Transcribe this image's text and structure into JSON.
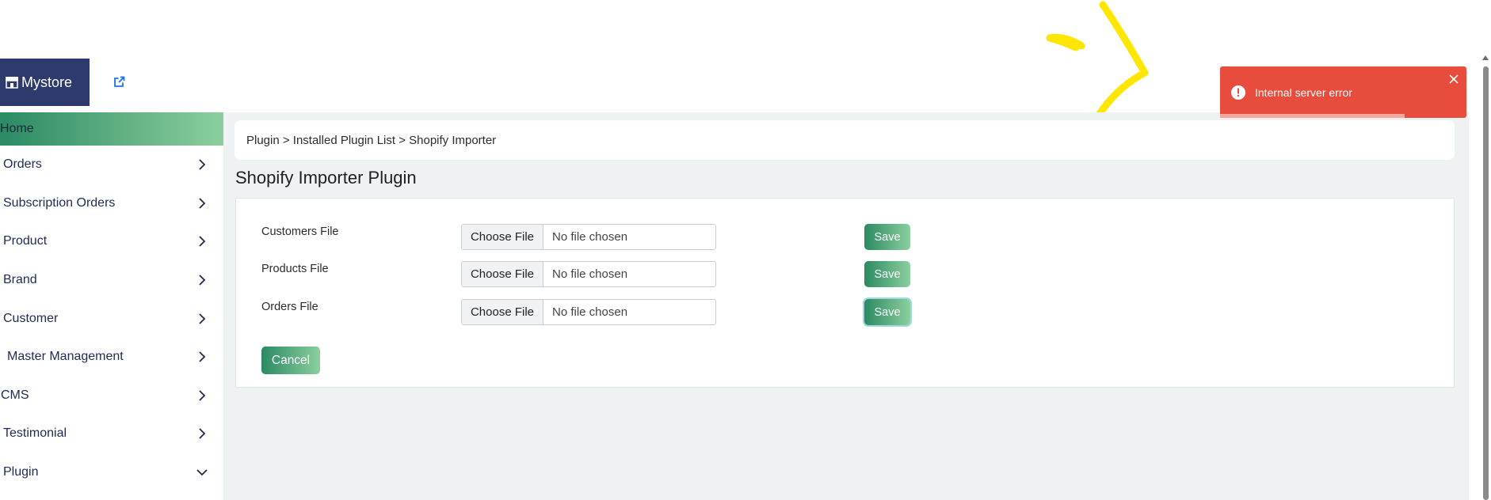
{
  "brand": {
    "logo_text": "Mystore",
    "external_link_icon": "external-link-icon",
    "colors": {
      "logo_bg": "#2d3a6b",
      "accent_start": "#2b8a63",
      "accent_end": "#8ccf9e"
    }
  },
  "sidebar": {
    "home": "Home",
    "items": [
      {
        "label": "Orders",
        "icon": "chevron-right-icon"
      },
      {
        "label": "Subscription Orders",
        "icon": "chevron-right-icon"
      },
      {
        "label": "Product",
        "icon": "chevron-right-icon"
      },
      {
        "label": "Brand",
        "icon": "chevron-right-icon"
      },
      {
        "label": "Customer",
        "icon": "chevron-right-icon"
      },
      {
        "label": "Master Management",
        "icon": "chevron-right-icon"
      },
      {
        "label": "CMS",
        "icon": "chevron-right-icon"
      },
      {
        "label": "Testimonial",
        "icon": "chevron-right-icon"
      },
      {
        "label": "Plugin",
        "icon": "chevron-down-icon"
      }
    ]
  },
  "breadcrumb": "Plugin > Installed Plugin List > Shopify Importer",
  "page_title": "Shopify Importer Plugin",
  "form": {
    "rows": [
      {
        "label": "Customers File",
        "choose": "Choose File",
        "status": "No file chosen",
        "save": "Save"
      },
      {
        "label": "Products File",
        "choose": "Choose File",
        "status": "No file chosen",
        "save": "Save"
      },
      {
        "label": "Orders File",
        "choose": "Choose File",
        "status": "No file chosen",
        "save": "Save"
      }
    ],
    "cancel": "Cancel"
  },
  "toast": {
    "message": "Internal server error",
    "icon": "error-circle-icon",
    "close_icon": "close-icon",
    "color": "#e74c3c"
  }
}
